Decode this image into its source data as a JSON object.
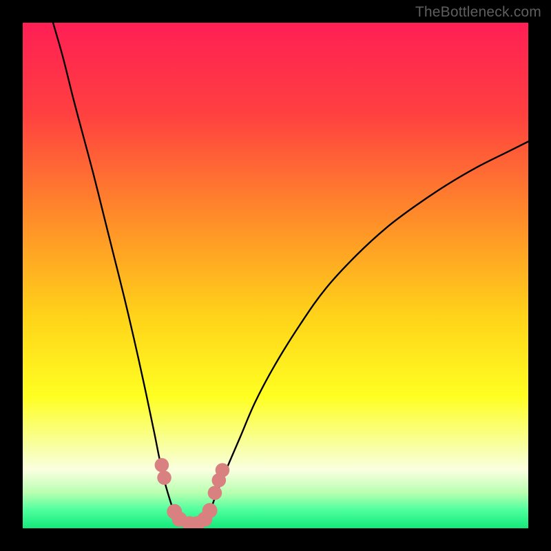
{
  "watermark": "TheBottleneck.com",
  "chart_data": {
    "type": "line",
    "title": "",
    "xlabel": "",
    "ylabel": "",
    "xlim": [
      0,
      100
    ],
    "ylim": [
      0,
      100
    ],
    "grid": false,
    "background": {
      "type": "vertical-gradient",
      "stops": [
        {
          "pos": 0.0,
          "color": "#ff1f55"
        },
        {
          "pos": 0.18,
          "color": "#ff4040"
        },
        {
          "pos": 0.38,
          "color": "#ff8a2a"
        },
        {
          "pos": 0.58,
          "color": "#ffd319"
        },
        {
          "pos": 0.74,
          "color": "#ffff22"
        },
        {
          "pos": 0.84,
          "color": "#f8ffa5"
        },
        {
          "pos": 0.885,
          "color": "#faffe0"
        },
        {
          "pos": 0.93,
          "color": "#b8ffb0"
        },
        {
          "pos": 0.965,
          "color": "#4bff9d"
        },
        {
          "pos": 1.0,
          "color": "#14e87a"
        }
      ]
    },
    "series": [
      {
        "name": "left-curve",
        "color": "#000000",
        "x": [
          6,
          8,
          10,
          12,
          14,
          16,
          18,
          20,
          22,
          24,
          26,
          27,
          28,
          29,
          30,
          31
        ],
        "y": [
          100,
          93,
          85,
          77.5,
          70,
          62,
          54,
          46,
          37.5,
          28.5,
          19,
          14,
          9.5,
          6,
          3,
          1
        ]
      },
      {
        "name": "right-curve",
        "color": "#000000",
        "x": [
          36,
          37,
          38,
          40,
          43,
          46,
          50,
          55,
          60,
          66,
          72,
          78,
          84,
          90,
          96,
          100
        ],
        "y": [
          1,
          3,
          6,
          11,
          18,
          25,
          32.5,
          40.5,
          47.5,
          54,
          59.5,
          64,
          68,
          71.5,
          74.5,
          76.5
        ]
      },
      {
        "name": "flat-minimum",
        "color": "#000000",
        "x": [
          31,
          33,
          34,
          36
        ],
        "y": [
          1,
          0.5,
          0.5,
          1
        ]
      }
    ],
    "markers": {
      "name": "highlighted-points",
      "color": "#d98080",
      "points": [
        {
          "x": 27.5,
          "y": 12.5,
          "r": 1.4
        },
        {
          "x": 28.0,
          "y": 10.0,
          "r": 1.4
        },
        {
          "x": 30.0,
          "y": 3.3,
          "r": 1.5
        },
        {
          "x": 31.0,
          "y": 1.8,
          "r": 1.5
        },
        {
          "x": 33.0,
          "y": 0.9,
          "r": 1.5
        },
        {
          "x": 34.5,
          "y": 0.9,
          "r": 1.5
        },
        {
          "x": 36.0,
          "y": 1.8,
          "r": 1.5
        },
        {
          "x": 37.0,
          "y": 3.5,
          "r": 1.5
        },
        {
          "x": 38.0,
          "y": 7.0,
          "r": 1.4
        },
        {
          "x": 38.8,
          "y": 9.5,
          "r": 1.4
        },
        {
          "x": 39.5,
          "y": 11.5,
          "r": 1.4
        }
      ]
    }
  }
}
